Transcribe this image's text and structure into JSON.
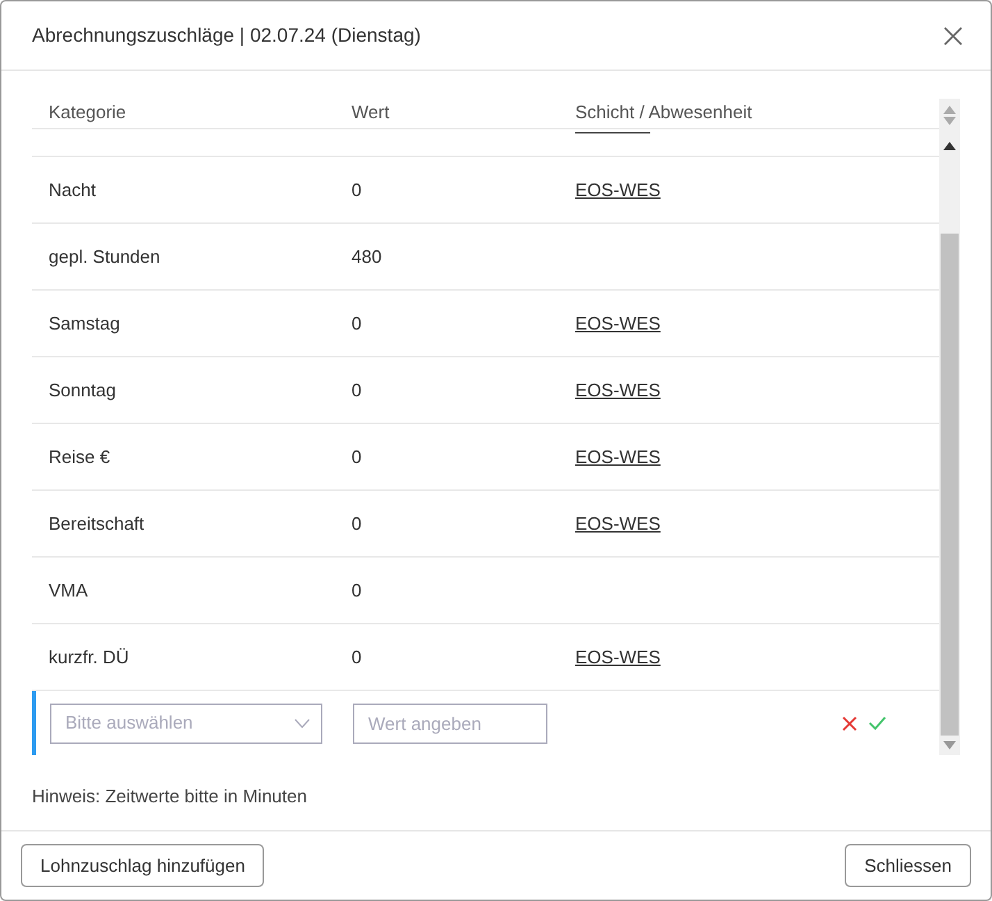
{
  "dialog": {
    "title": "Abrechnungszuschläge | 02.07.24 (Dienstag)"
  },
  "table": {
    "columns": [
      "Kategorie",
      "Wert",
      "Schicht / Abwesenheit"
    ],
    "rows": [
      {
        "category": "Nacht",
        "value": "0",
        "shift": "EOS-WES"
      },
      {
        "category": "gepl. Stunden",
        "value": "480"
      },
      {
        "category": "Samstag",
        "value": "0",
        "shift": "EOS-WES"
      },
      {
        "category": "Sonntag",
        "value": "0",
        "shift": "EOS-WES"
      },
      {
        "category": "Reise €",
        "value": "0",
        "shift": "EOS-WES"
      },
      {
        "category": "Bereitschaft",
        "value": "0",
        "shift": "EOS-WES"
      },
      {
        "category": "VMA",
        "value": "0"
      },
      {
        "category": "kurzfr. DÜ",
        "value": "0",
        "shift": "EOS-WES"
      }
    ],
    "new_row": {
      "category_placeholder": "Bitte auswählen",
      "value_placeholder": "Wert angeben"
    }
  },
  "hint": "Hinweis: Zeitwerte bitte in Minuten",
  "buttons": {
    "add": "Lohnzuschlag hinzufügen",
    "close": "Schliessen"
  }
}
